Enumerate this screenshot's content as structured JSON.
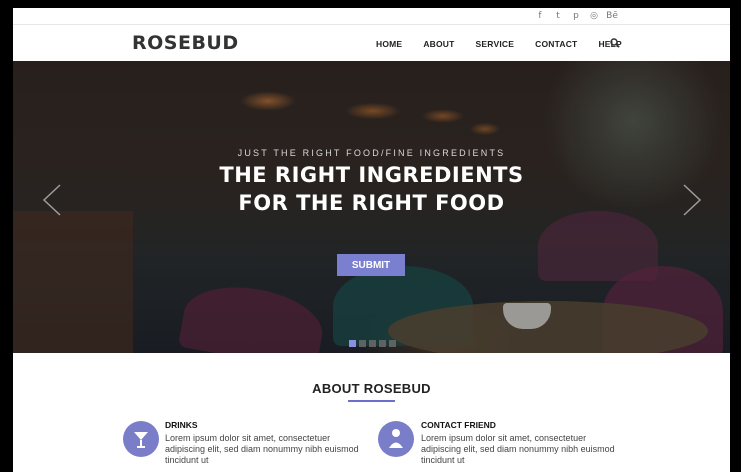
{
  "social": [
    {
      "icon": "facebook-icon",
      "glyph": "f"
    },
    {
      "icon": "twitter-icon",
      "glyph": "t"
    },
    {
      "icon": "pinterest-icon",
      "glyph": "p"
    },
    {
      "icon": "dribbble-icon",
      "glyph": "◎"
    },
    {
      "icon": "behance-icon",
      "glyph": "Bē"
    }
  ],
  "brand": "ROSEBUD",
  "menu": [
    "HOME",
    "ABOUT",
    "SERVICE",
    "CONTACT",
    "HELP"
  ],
  "hero": {
    "kicker": "JUST THE RIGHT FOOD/FINE INGREDIENTS",
    "headline_1": "THE RIGHT INGREDIENTS",
    "headline_2": "FOR THE RIGHT FOOD",
    "button": "SUBMIT",
    "slides": 5,
    "active_slide": 1
  },
  "about": {
    "title": "ABOUT ROSEBUD",
    "features": [
      {
        "title": "DRINKS",
        "text": "Lorem ipsum dolor sit amet, consectetuer adipiscing elit, sed diam nonummy nibh euismod tincidunt ut",
        "icon": "cocktail-glass-icon"
      },
      {
        "title": "CONTACT FRIEND",
        "text": "Lorem ipsum dolor sit amet, consectetuer adipiscing elit, sed diam nonummy nibh euismod tincidunt ut",
        "icon": "person-icon"
      }
    ]
  },
  "colors": {
    "accent": "#7b7fd0",
    "brand_text": "#333333"
  }
}
